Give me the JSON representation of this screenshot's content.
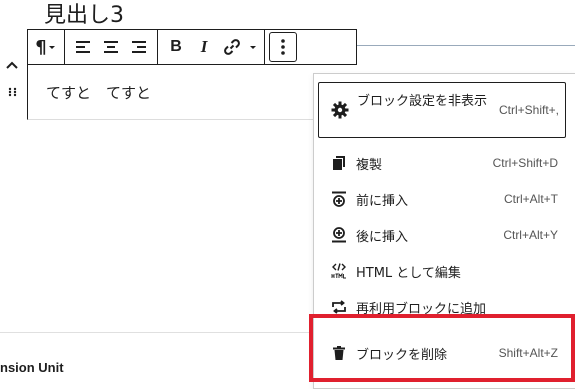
{
  "heading": "見出し3",
  "block": {
    "text": "てすと　てすと"
  },
  "footer": {
    "text": "nsion Unit"
  },
  "toolbar": {
    "paragraph_glyph": "¶",
    "bold_glyph": "B",
    "italic_glyph": "I"
  },
  "menu": {
    "items": [
      {
        "label": "ブロック設定を非表示",
        "shortcut": "Ctrl+Shift+,",
        "icon": "gear-icon"
      },
      {
        "label": "複製",
        "shortcut": "Ctrl+Shift+D",
        "icon": "duplicate-icon"
      },
      {
        "label": "前に挿入",
        "shortcut": "Ctrl+Alt+T",
        "icon": "insert-before-icon"
      },
      {
        "label": "後に挿入",
        "shortcut": "Ctrl+Alt+Y",
        "icon": "insert-after-icon"
      },
      {
        "label": "HTML として編集",
        "shortcut": "",
        "icon": "html-icon"
      },
      {
        "label": "再利用ブロックに追加",
        "shortcut": "",
        "icon": "reusable-icon"
      },
      {
        "label": "ブロックを削除",
        "shortcut": "Shift+Alt+Z",
        "icon": "trash-icon"
      }
    ]
  },
  "colors": {
    "highlight": "#e0202e",
    "text": "#1e1e1e"
  }
}
